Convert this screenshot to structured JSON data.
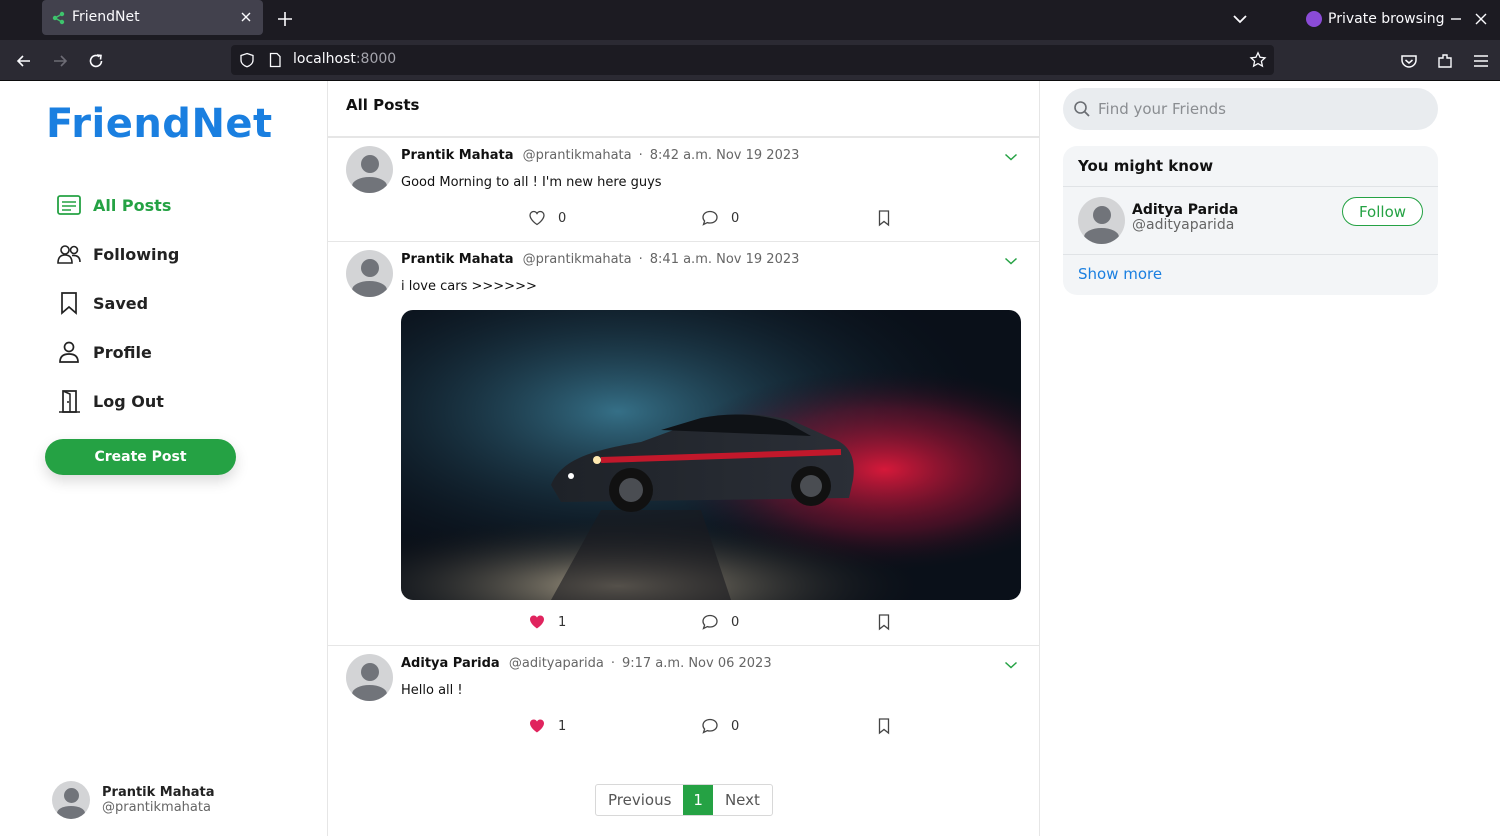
{
  "browser": {
    "tab_title": "FriendNet",
    "url_host": "localhost",
    "url_port": ":8000",
    "private_label": "Private browsing"
  },
  "app": {
    "logo": "FriendNet",
    "nav": [
      {
        "label": "All Posts",
        "icon": "list-icon",
        "active": true
      },
      {
        "label": "Following",
        "icon": "people-icon",
        "active": false
      },
      {
        "label": "Saved",
        "icon": "bookmark-icon",
        "active": false
      },
      {
        "label": "Profile",
        "icon": "person-icon",
        "active": false
      },
      {
        "label": "Log Out",
        "icon": "door-icon",
        "active": false
      }
    ],
    "create_post_label": "Create Post",
    "current_user": {
      "name": "Prantik Mahata",
      "handle": "@prantikmahata"
    }
  },
  "feed": {
    "title": "All Posts",
    "posts": [
      {
        "author": "Prantik Mahata",
        "handle": "@prantikmahata",
        "time": "8:42 a.m. Nov 19 2023",
        "text": "Good Morning to all ! I'm new here guys",
        "likes": "0",
        "liked": false,
        "comments": "0",
        "has_image": false
      },
      {
        "author": "Prantik Mahata",
        "handle": "@prantikmahata",
        "time": "8:41 a.m. Nov 19 2023",
        "text": "i love cars >>>>>>",
        "likes": "1",
        "liked": true,
        "comments": "0",
        "has_image": true
      },
      {
        "author": "Aditya Parida",
        "handle": "@adityaparida",
        "time": "9:17 a.m. Nov 06 2023",
        "text": "Hello all !",
        "likes": "1",
        "liked": true,
        "comments": "0",
        "has_image": false
      }
    ],
    "pagination": {
      "previous": "Previous",
      "current": "1",
      "next": "Next"
    }
  },
  "right": {
    "search_placeholder": "Find your Friends",
    "suggest_title": "You might know",
    "suggestion": {
      "name": "Aditya Parida",
      "handle": "@adityaparida",
      "follow_label": "Follow"
    },
    "show_more": "Show more"
  },
  "colors": {
    "brand": "#1a7fe0",
    "accent": "#25a244",
    "like": "#e0245e"
  }
}
